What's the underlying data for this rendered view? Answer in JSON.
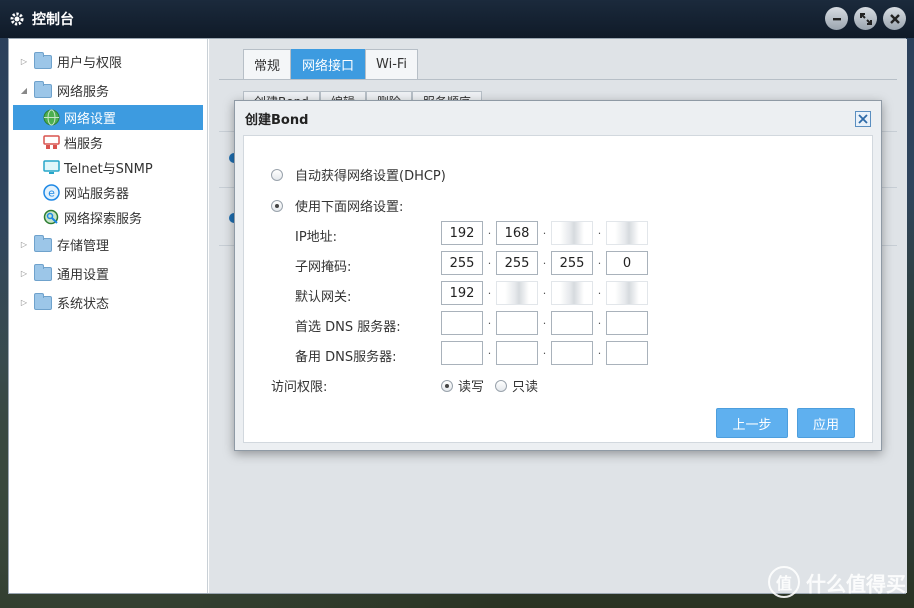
{
  "window": {
    "title": "控制台"
  },
  "sidebar": {
    "items": [
      {
        "label": "用户与权限",
        "expanded": false
      },
      {
        "label": "网络服务",
        "expanded": true,
        "children": [
          {
            "label": "网络设置",
            "icon": "globe-icon",
            "selected": true
          },
          {
            "label": "档服务",
            "icon": "file-server-icon"
          },
          {
            "label": "Telnet与SNMP",
            "icon": "monitor-icon"
          },
          {
            "label": "网站服务器",
            "icon": "web-server-icon"
          },
          {
            "label": "网络探索服务",
            "icon": "discovery-icon"
          }
        ]
      },
      {
        "label": "存储管理",
        "expanded": false
      },
      {
        "label": "通用设置",
        "expanded": false
      },
      {
        "label": "系统状态",
        "expanded": false
      }
    ]
  },
  "tabs": [
    "常规",
    "网络接口",
    "Wi-Fi"
  ],
  "subtabs": [
    "创建Bond",
    "编辑",
    "删除",
    "服务顺序"
  ],
  "dialog": {
    "title": "创建Bond",
    "option_dhcp": "自动获得网络设置(DHCP)",
    "option_manual": "使用下面网络设置:",
    "fields": {
      "ip_label": "IP地址:",
      "ip": [
        "192",
        "168",
        "",
        ""
      ],
      "mask_label": "子网掩码:",
      "mask": [
        "255",
        "255",
        "255",
        "0"
      ],
      "gateway_label": "默认网关:",
      "gateway": [
        "192",
        "",
        "",
        ""
      ],
      "dns1_label": "首选 DNS 服务器:",
      "dns1": [
        "",
        "",
        "",
        ""
      ],
      "dns2_label": "备用 DNS服务器:",
      "dns2": [
        "",
        "",
        "",
        ""
      ]
    },
    "access_label": "访问权限:",
    "access_rw": "读写",
    "access_ro": "只读",
    "back_button": "上一步",
    "apply_button": "应用"
  },
  "watermark": "什么值得买",
  "colors": {
    "accent": "#3d9be0",
    "button": "#5fb0ef"
  }
}
